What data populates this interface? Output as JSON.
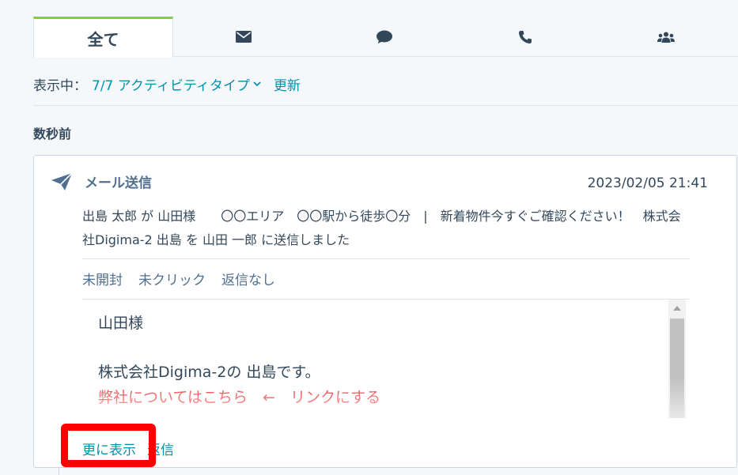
{
  "tabs": [
    {
      "label": "全て",
      "active": true
    },
    {
      "icon": "envelope-icon"
    },
    {
      "icon": "chat-bubble-icon"
    },
    {
      "icon": "phone-icon"
    },
    {
      "icon": "people-icon"
    }
  ],
  "filter": {
    "label": "表示中：",
    "value": "7/7 アクティビティタイプ",
    "refresh": "更新"
  },
  "section_title": "数秒前",
  "activity": {
    "icon": "send-icon",
    "type": "メール送信",
    "timestamp": "2023/02/05 21:41",
    "description": "出島 太郎 が 山田様　　〇〇エリア　〇〇駅から徒歩〇分　|　新着物件今すぐご確認ください！　株式会社Digima-2 出島 を 山田 一郎 に送信しました",
    "statuses": [
      "未開封",
      "未クリック",
      "返信なし"
    ],
    "body": {
      "line1": "山田様",
      "line2": "株式会社Digima-2の 出島です。",
      "line3": "弊社についてはこちら　←　リンクにする"
    },
    "actions": {
      "show_more": "更に表示",
      "reply": "返信"
    }
  },
  "colors": {
    "accent_tab": "#7fd13b",
    "link": "#0091ae",
    "highlight": "#ff0000",
    "mail_link": "#f2545b"
  }
}
